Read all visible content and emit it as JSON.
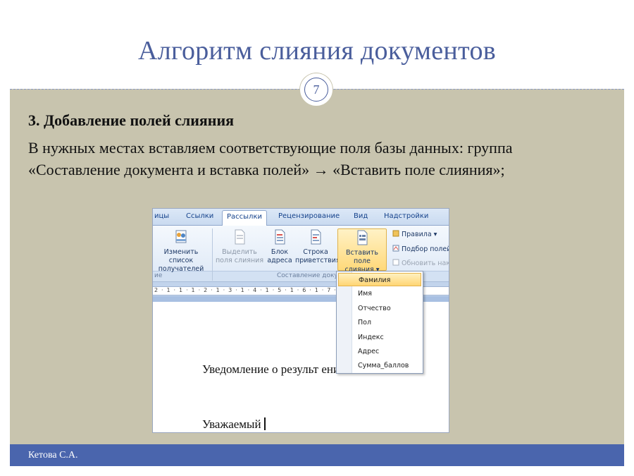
{
  "slide": {
    "title": "Алгоритм слияния документов",
    "page_number": "7",
    "heading": "3. Добавление полей слияния",
    "body": "В нужных местах вставляем соответствующие поля базы данных: группа «Составление документа и вставка полей» → «Вставить поле слияния»;",
    "footer": "Кетова С.А."
  },
  "colors": {
    "title": "#4a5e9c",
    "content_bg": "#c8c4ae",
    "footer_bg": "#4a65ad"
  },
  "word": {
    "tabs": [
      {
        "label": "ицы"
      },
      {
        "label": "Ссылки"
      },
      {
        "label": "Рассылки",
        "active": true
      },
      {
        "label": "Рецензирование"
      },
      {
        "label": "Вид"
      },
      {
        "label": "Надстройки"
      }
    ],
    "ribbon": {
      "edit_list_line1": "Изменить список",
      "edit_list_line2": "получателей",
      "highlight_fields_line1": "Выделить",
      "highlight_fields_line2": "поля слияния",
      "address_block_line1": "Блок",
      "address_block_line2": "адреса",
      "greeting_line1": "Строка",
      "greeting_line2": "приветствия",
      "insert_field_line1": "Вставить поле",
      "insert_field_line2": "слияния ▾",
      "rules": "Правила ▾",
      "match_fields": "Подбор полей",
      "update_labels": "Обновить нак.",
      "group_left": "ие",
      "group_compose": "Составление доку"
    },
    "ruler": "2 · 1 · 1 · 1 · 2 · 1 · 3 · 1 · 4 · 1 · 5 · 1 · 6 · 1 · 7 · 1 · 8 · 1 · 9 · 1 ·10·",
    "document": {
      "line1": "Уведомление о результ                       ения",
      "line2": "Уважаемый"
    },
    "dropdown_items": [
      {
        "label": "Фамилия",
        "selected": true
      },
      {
        "label": "Имя"
      },
      {
        "label": "Отчество"
      },
      {
        "label": "Пол"
      },
      {
        "label": "Индекс"
      },
      {
        "label": "Адрес"
      },
      {
        "label": "Сумма_баллов"
      }
    ]
  }
}
